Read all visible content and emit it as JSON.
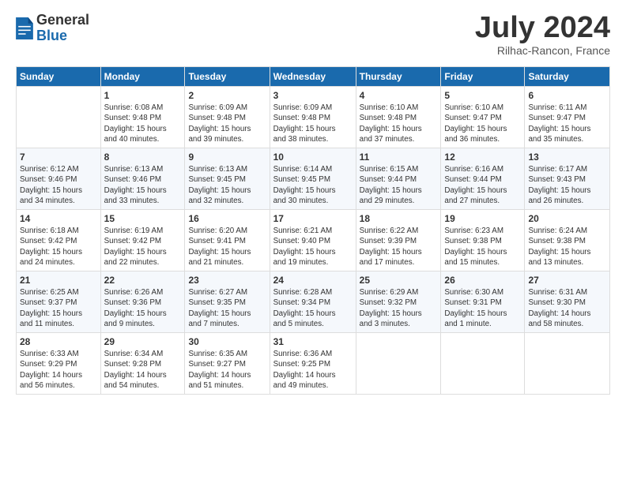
{
  "logo": {
    "general": "General",
    "blue": "Blue"
  },
  "title": "July 2024",
  "location": "Rilhac-Rancon, France",
  "days_header": [
    "Sunday",
    "Monday",
    "Tuesday",
    "Wednesday",
    "Thursday",
    "Friday",
    "Saturday"
  ],
  "weeks": [
    [
      {
        "day": "",
        "text": ""
      },
      {
        "day": "1",
        "text": "Sunrise: 6:08 AM\nSunset: 9:48 PM\nDaylight: 15 hours\nand 40 minutes."
      },
      {
        "day": "2",
        "text": "Sunrise: 6:09 AM\nSunset: 9:48 PM\nDaylight: 15 hours\nand 39 minutes."
      },
      {
        "day": "3",
        "text": "Sunrise: 6:09 AM\nSunset: 9:48 PM\nDaylight: 15 hours\nand 38 minutes."
      },
      {
        "day": "4",
        "text": "Sunrise: 6:10 AM\nSunset: 9:48 PM\nDaylight: 15 hours\nand 37 minutes."
      },
      {
        "day": "5",
        "text": "Sunrise: 6:10 AM\nSunset: 9:47 PM\nDaylight: 15 hours\nand 36 minutes."
      },
      {
        "day": "6",
        "text": "Sunrise: 6:11 AM\nSunset: 9:47 PM\nDaylight: 15 hours\nand 35 minutes."
      }
    ],
    [
      {
        "day": "7",
        "text": "Sunrise: 6:12 AM\nSunset: 9:46 PM\nDaylight: 15 hours\nand 34 minutes."
      },
      {
        "day": "8",
        "text": "Sunrise: 6:13 AM\nSunset: 9:46 PM\nDaylight: 15 hours\nand 33 minutes."
      },
      {
        "day": "9",
        "text": "Sunrise: 6:13 AM\nSunset: 9:45 PM\nDaylight: 15 hours\nand 32 minutes."
      },
      {
        "day": "10",
        "text": "Sunrise: 6:14 AM\nSunset: 9:45 PM\nDaylight: 15 hours\nand 30 minutes."
      },
      {
        "day": "11",
        "text": "Sunrise: 6:15 AM\nSunset: 9:44 PM\nDaylight: 15 hours\nand 29 minutes."
      },
      {
        "day": "12",
        "text": "Sunrise: 6:16 AM\nSunset: 9:44 PM\nDaylight: 15 hours\nand 27 minutes."
      },
      {
        "day": "13",
        "text": "Sunrise: 6:17 AM\nSunset: 9:43 PM\nDaylight: 15 hours\nand 26 minutes."
      }
    ],
    [
      {
        "day": "14",
        "text": "Sunrise: 6:18 AM\nSunset: 9:42 PM\nDaylight: 15 hours\nand 24 minutes."
      },
      {
        "day": "15",
        "text": "Sunrise: 6:19 AM\nSunset: 9:42 PM\nDaylight: 15 hours\nand 22 minutes."
      },
      {
        "day": "16",
        "text": "Sunrise: 6:20 AM\nSunset: 9:41 PM\nDaylight: 15 hours\nand 21 minutes."
      },
      {
        "day": "17",
        "text": "Sunrise: 6:21 AM\nSunset: 9:40 PM\nDaylight: 15 hours\nand 19 minutes."
      },
      {
        "day": "18",
        "text": "Sunrise: 6:22 AM\nSunset: 9:39 PM\nDaylight: 15 hours\nand 17 minutes."
      },
      {
        "day": "19",
        "text": "Sunrise: 6:23 AM\nSunset: 9:38 PM\nDaylight: 15 hours\nand 15 minutes."
      },
      {
        "day": "20",
        "text": "Sunrise: 6:24 AM\nSunset: 9:38 PM\nDaylight: 15 hours\nand 13 minutes."
      }
    ],
    [
      {
        "day": "21",
        "text": "Sunrise: 6:25 AM\nSunset: 9:37 PM\nDaylight: 15 hours\nand 11 minutes."
      },
      {
        "day": "22",
        "text": "Sunrise: 6:26 AM\nSunset: 9:36 PM\nDaylight: 15 hours\nand 9 minutes."
      },
      {
        "day": "23",
        "text": "Sunrise: 6:27 AM\nSunset: 9:35 PM\nDaylight: 15 hours\nand 7 minutes."
      },
      {
        "day": "24",
        "text": "Sunrise: 6:28 AM\nSunset: 9:34 PM\nDaylight: 15 hours\nand 5 minutes."
      },
      {
        "day": "25",
        "text": "Sunrise: 6:29 AM\nSunset: 9:32 PM\nDaylight: 15 hours\nand 3 minutes."
      },
      {
        "day": "26",
        "text": "Sunrise: 6:30 AM\nSunset: 9:31 PM\nDaylight: 15 hours\nand 1 minute."
      },
      {
        "day": "27",
        "text": "Sunrise: 6:31 AM\nSunset: 9:30 PM\nDaylight: 14 hours\nand 58 minutes."
      }
    ],
    [
      {
        "day": "28",
        "text": "Sunrise: 6:33 AM\nSunset: 9:29 PM\nDaylight: 14 hours\nand 56 minutes."
      },
      {
        "day": "29",
        "text": "Sunrise: 6:34 AM\nSunset: 9:28 PM\nDaylight: 14 hours\nand 54 minutes."
      },
      {
        "day": "30",
        "text": "Sunrise: 6:35 AM\nSunset: 9:27 PM\nDaylight: 14 hours\nand 51 minutes."
      },
      {
        "day": "31",
        "text": "Sunrise: 6:36 AM\nSunset: 9:25 PM\nDaylight: 14 hours\nand 49 minutes."
      },
      {
        "day": "",
        "text": ""
      },
      {
        "day": "",
        "text": ""
      },
      {
        "day": "",
        "text": ""
      }
    ]
  ]
}
